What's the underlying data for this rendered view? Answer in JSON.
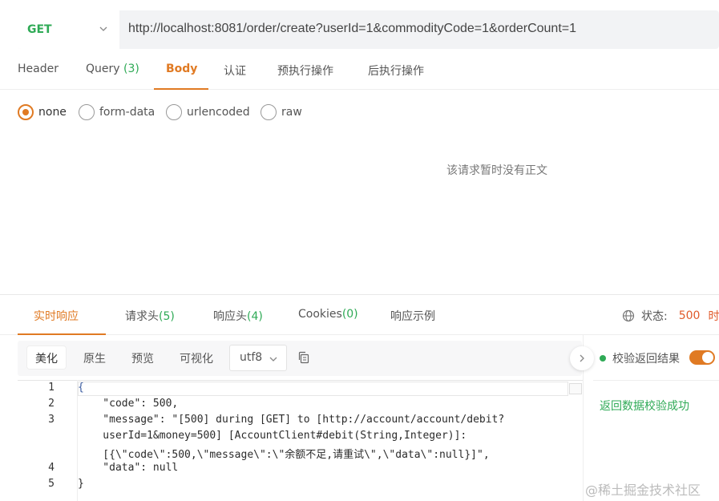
{
  "request": {
    "method": "GET",
    "url": "http://localhost:8081/order/create?userId=1&commodityCode=1&orderCount=1"
  },
  "request_tabs": [
    {
      "label": "Header",
      "count": ""
    },
    {
      "label": "Query ",
      "count": "(3)"
    },
    {
      "label": "Body",
      "count": ""
    },
    {
      "label": "认证",
      "count": ""
    },
    {
      "label": "预执行操作",
      "count": ""
    },
    {
      "label": "后执行操作",
      "count": ""
    }
  ],
  "body_types": [
    "none",
    "form-data",
    "urlencoded",
    "raw"
  ],
  "body_empty_text": "该请求暂时没有正文",
  "response_tabs": [
    {
      "label": "实时响应",
      "count": ""
    },
    {
      "label": "请求头",
      "count": "(5)"
    },
    {
      "label": "响应头",
      "count": "(4)"
    },
    {
      "label": "Cookies",
      "count": "(0)"
    },
    {
      "label": "响应示例",
      "count": ""
    }
  ],
  "status": {
    "label": "状态:",
    "value": "500",
    "trail": "时"
  },
  "format_buttons": [
    "美化",
    "原生",
    "预览",
    "可视化"
  ],
  "encoding": "utf8",
  "code_lines": [
    {
      "no": "1",
      "text": "{"
    },
    {
      "no": "2",
      "text": "    \"code\": 500,"
    },
    {
      "no": "3",
      "text": "    \"message\": \"[500] during [GET] to [http://account/account/debit?"
    },
    {
      "no": "",
      "text": "    userId=1&money=500] [AccountClient#debit(String,Integer)]:"
    },
    {
      "no": "",
      "text": "    [{\\\"code\\\":500,\\\"message\\\":\\\"余额不足,请重试\\\",\\\"data\\\":null}]\","
    },
    {
      "no": "4",
      "text": "    \"data\": null"
    },
    {
      "no": "5",
      "text": "}"
    }
  ],
  "validation": {
    "label": "校验返回结果",
    "enabled": true,
    "message": "返回数据校验成功"
  },
  "watermark": "@稀土掘金技术社区",
  "colors": {
    "accent": "#e07a23",
    "success": "#2faa56",
    "error": "#e05a2b"
  }
}
